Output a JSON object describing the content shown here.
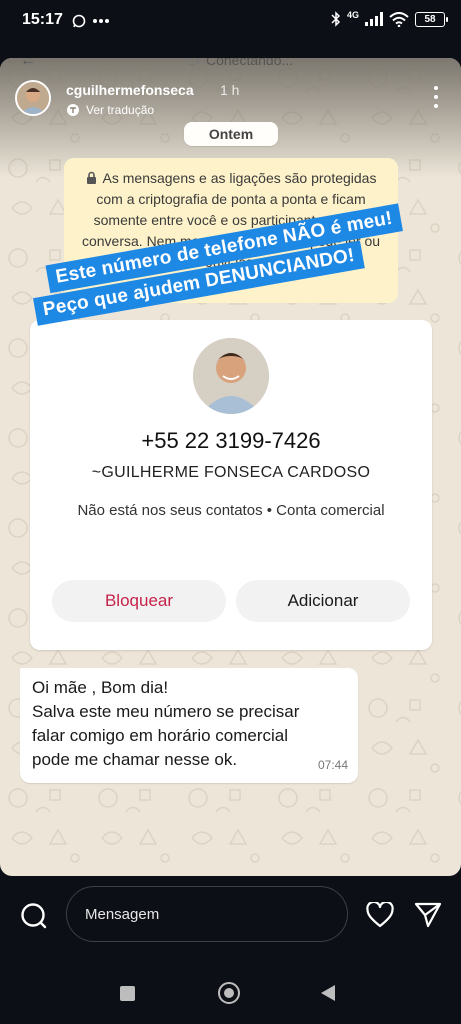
{
  "status_bar": {
    "time": "15:17",
    "network": "4G",
    "battery": "58"
  },
  "background_header": {
    "connecting_label": "Conectando..."
  },
  "story": {
    "username": "cguilhermefonseca",
    "time_ago": "1 h",
    "translate_label": "Ver tradução"
  },
  "chat": {
    "date_label": "Ontem",
    "encryption_notice": "As mensagens e as ligações são protegidas com a criptografia de ponta a ponta e ficam somente entre você e os participantes desta conversa. Nem mesmo o WhatsApp pode ler ou ouvi-las."
  },
  "banner": {
    "line1": "Este número de telefone NÃO é meu!",
    "line2": "Peço que ajudem DENUNCIANDO!"
  },
  "contact_card": {
    "phone": "+55 22 3199-7426",
    "name": "~GUILHERME FONSECA CARDOSO",
    "info": "Não está nos seus contatos • Conta comercial",
    "block_label": "Bloquear",
    "add_label": "Adicionar"
  },
  "message": {
    "lines": [
      "Oi mãe , Bom dia!",
      "Salva este meu número se precisar",
      "falar comigo em horário comercial",
      "pode me chamar nesse ok."
    ],
    "time": "07:44"
  },
  "reply_bar": {
    "placeholder": "Mensagem"
  },
  "colors": {
    "banner_blue": "#1e88e5",
    "block_red": "#c6234a",
    "chat_bg": "#ece5d8",
    "encryption_bg": "#fdf2c9"
  },
  "icons": [
    "wifi-icon",
    "signal-icon",
    "bluetooth-icon",
    "lock-icon",
    "camera-icon",
    "heart-icon",
    "send-icon",
    "translate-icon",
    "more-icon"
  ]
}
